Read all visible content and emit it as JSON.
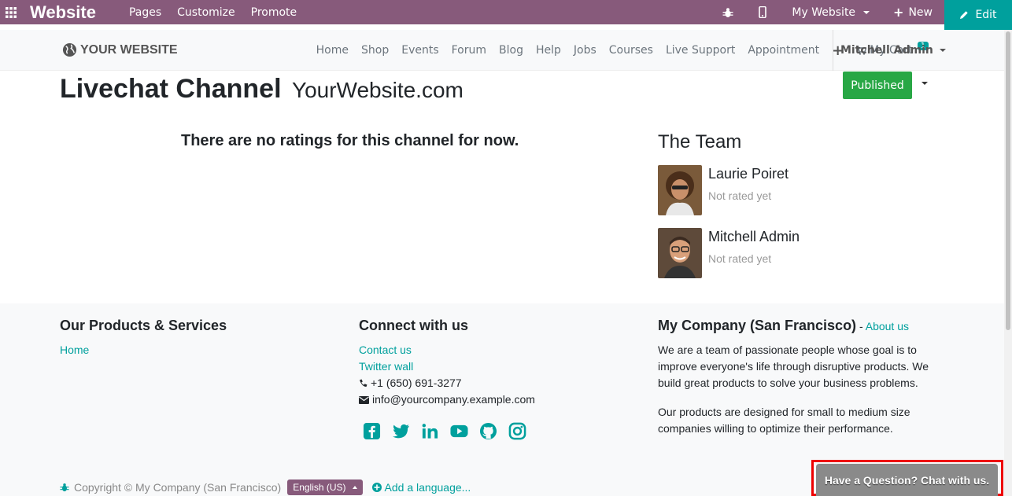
{
  "topbar": {
    "brand": "Website",
    "menu": [
      "Pages",
      "Customize",
      "Promote"
    ],
    "website_selector": "My Website",
    "new_label": "New",
    "edit_label": "Edit"
  },
  "header": {
    "logo_text": "YOUR WEBSITE",
    "nav": [
      "Home",
      "Shop",
      "Events",
      "Forum",
      "Blog",
      "Help",
      "Jobs",
      "Courses",
      "Live Support",
      "Appointment"
    ],
    "cart_label": "My Cart",
    "cart_count": "1",
    "user": "Mitchell Admin"
  },
  "main": {
    "title": "Livechat Channel",
    "subtitle": "YourWebsite.com",
    "published_label": "Published",
    "no_ratings": "There are no ratings for this channel for now.",
    "team_title": "The Team",
    "members": [
      {
        "name": "Laurie Poiret",
        "rating": "Not rated yet"
      },
      {
        "name": "Mitchell Admin",
        "rating": "Not rated yet"
      }
    ]
  },
  "footer": {
    "col1": {
      "title": "Our Products & Services",
      "links": [
        "Home"
      ]
    },
    "col2": {
      "title": "Connect with us",
      "links": [
        "Contact us",
        "Twitter wall"
      ],
      "phone": "+1 (650) 691-3277",
      "email": "info@yourcompany.example.com"
    },
    "col3": {
      "title": "My Company (San Francisco)",
      "about_sep": " - ",
      "about_link": "About us",
      "p1": "We are a team of passionate people whose goal is to improve everyone's life through disruptive products. We build great products to solve your business problems.",
      "p2": "Our products are designed for small to medium size companies willing to optimize their performance."
    },
    "copyright": "Copyright © My Company (San Francisco)",
    "language": "English (US)",
    "add_language": "Add a language..."
  },
  "chat": {
    "label": "Have a Question? Chat with us."
  },
  "colors": {
    "odoo_purple": "#875a7b",
    "teal": "#00a09d",
    "green": "#28a745",
    "highlight": "#e00000"
  }
}
